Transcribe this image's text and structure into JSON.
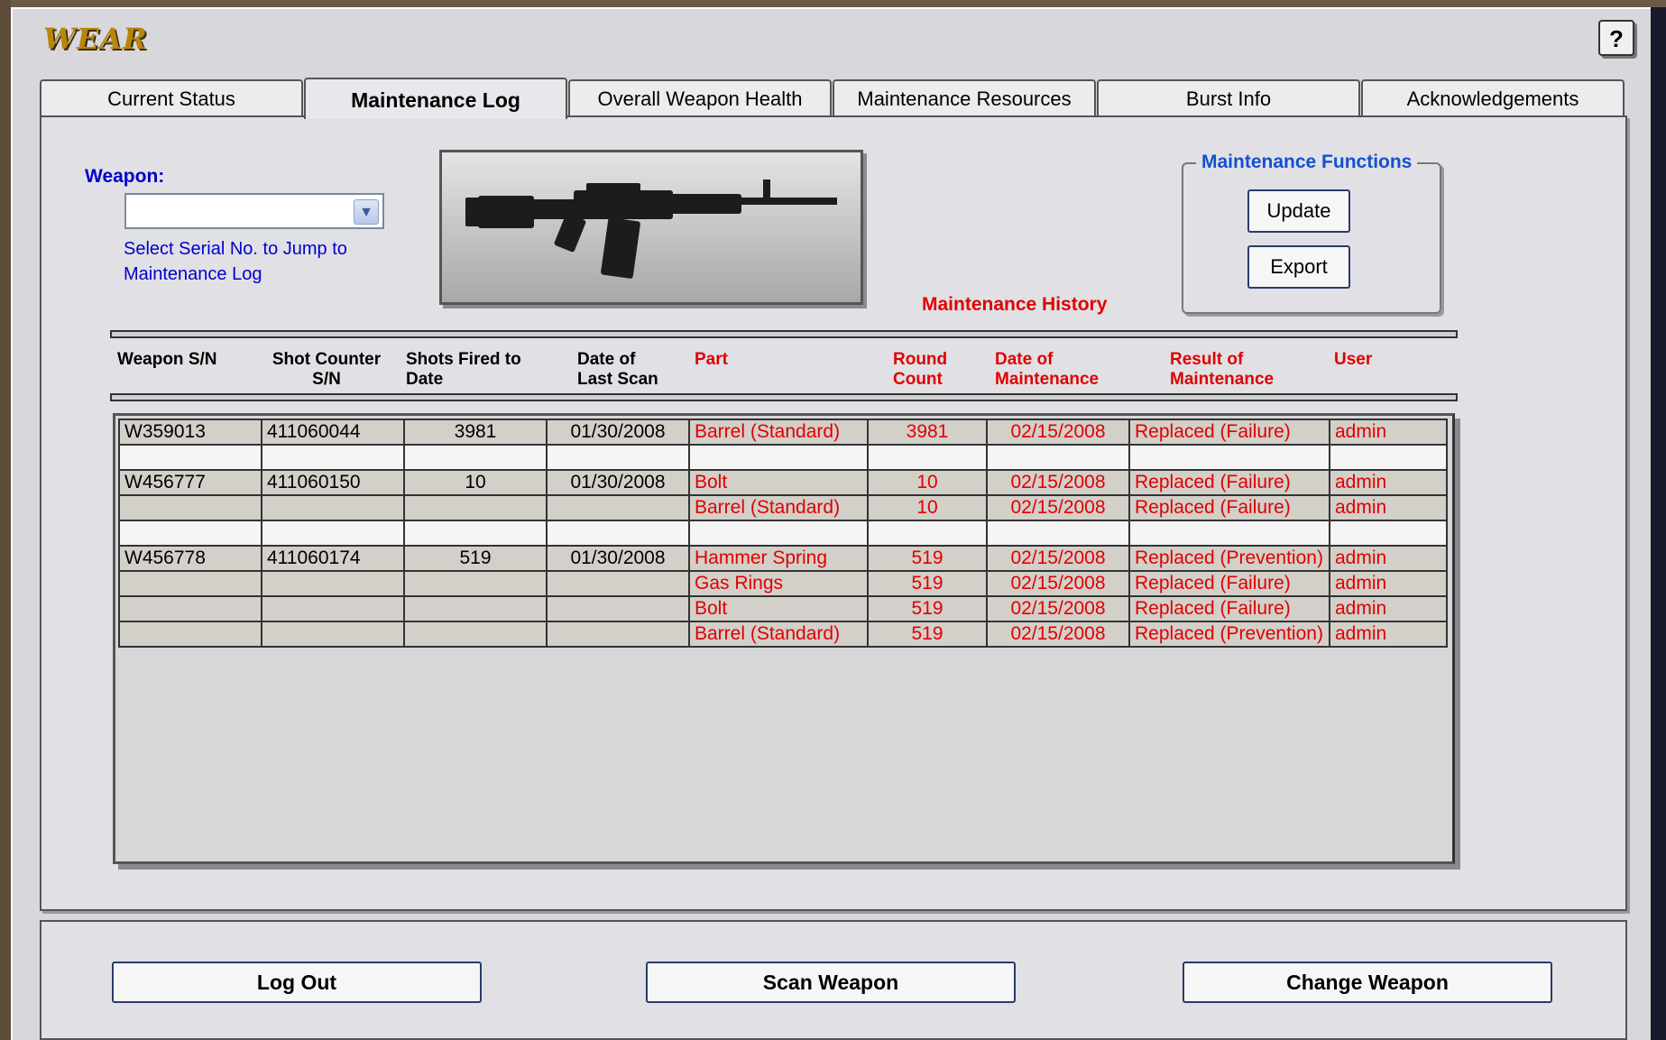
{
  "app": {
    "title": "WEAR",
    "help_label": "?"
  },
  "tabs": [
    {
      "label": "Current Status"
    },
    {
      "label": "Maintenance Log",
      "active": true
    },
    {
      "label": "Overall Weapon Health"
    },
    {
      "label": "Maintenance Resources"
    },
    {
      "label": "Burst Info"
    },
    {
      "label": "Acknowledgements"
    }
  ],
  "weapon_select": {
    "label": "Weapon:",
    "value": "",
    "hint_line1": "Select Serial No. to Jump to",
    "hint_line2": "Maintenance Log"
  },
  "maintenance_functions": {
    "title": "Maintenance Functions",
    "update_label": "Update",
    "export_label": "Export"
  },
  "history": {
    "title": "Maintenance History",
    "headers": [
      {
        "line1": "Weapon S/N",
        "line2": ""
      },
      {
        "line1": "Shot Counter",
        "line2": "S/N"
      },
      {
        "line1": "Shots Fired to",
        "line2": "Date"
      },
      {
        "line1": "Date of",
        "line2": "Last Scan"
      },
      {
        "line1": "Part",
        "line2": ""
      },
      {
        "line1": "Round",
        "line2": "Count"
      },
      {
        "line1": "Date of",
        "line2": "Maintenance"
      },
      {
        "line1": "Result of",
        "line2": "Maintenance"
      },
      {
        "line1": "User",
        "line2": ""
      }
    ],
    "rows": [
      [
        "W359013",
        "411060044",
        "3981",
        "01/30/2008",
        "Barrel (Standard)",
        "3981",
        "02/15/2008",
        "Replaced (Failure)",
        "admin"
      ],
      [
        "",
        "",
        "",
        "",
        "",
        "",
        "",
        "",
        ""
      ],
      [
        "W456777",
        "411060150",
        "10",
        "01/30/2008",
        "Bolt",
        "10",
        "02/15/2008",
        "Replaced (Failure)",
        "admin"
      ],
      [
        "",
        "",
        "",
        "",
        "Barrel (Standard)",
        "10",
        "02/15/2008",
        "Replaced (Failure)",
        "admin"
      ],
      [
        "",
        "",
        "",
        "",
        "",
        "",
        "",
        "",
        ""
      ],
      [
        "W456778",
        "411060174",
        "519",
        "01/30/2008",
        "Hammer Spring",
        "519",
        "02/15/2008",
        "Replaced (Prevention)",
        "admin"
      ],
      [
        "",
        "",
        "",
        "",
        "Gas Rings",
        "519",
        "02/15/2008",
        "Replaced (Failure)",
        "admin"
      ],
      [
        "",
        "",
        "",
        "",
        "Bolt",
        "519",
        "02/15/2008",
        "Replaced (Failure)",
        "admin"
      ],
      [
        "",
        "",
        "",
        "",
        "Barrel (Standard)",
        "519",
        "02/15/2008",
        "Replaced (Prevention)",
        "admin"
      ]
    ]
  },
  "footer": {
    "logout_label": "Log Out",
    "scan_label": "Scan Weapon",
    "change_label": "Change Weapon"
  },
  "colors": {
    "accent_blue": "#0000cc",
    "history_red": "#e00000",
    "title_gold": "#b8860b"
  }
}
